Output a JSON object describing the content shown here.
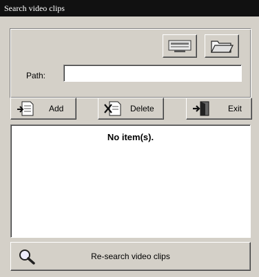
{
  "window": {
    "title": "Search video clips"
  },
  "toolbar": {
    "device_icon": "drive-icon",
    "folder_icon": "folder-icon"
  },
  "path": {
    "label": "Path:",
    "value": ""
  },
  "actions": {
    "add": "Add",
    "delete": "Delete",
    "exit": "Exit"
  },
  "list": {
    "empty_message": "No item(s)."
  },
  "research": {
    "label": "Re-search video clips"
  }
}
